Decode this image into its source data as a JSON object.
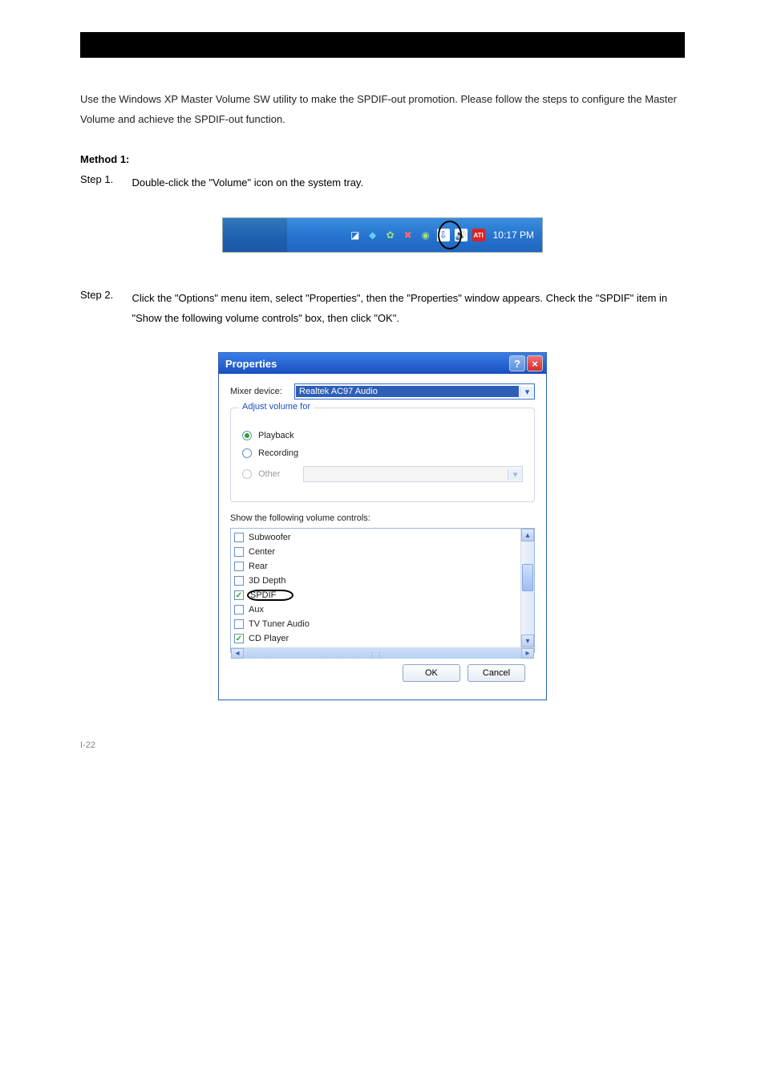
{
  "page_number": "I-22",
  "intro_paragraph": "Use the Windows XP Master Volume SW utility to make the SPDIF-out promotion. Please follow the steps to configure the Master Volume and achieve the SPDIF-out function.",
  "method_title": "Method 1:",
  "steps": [
    {
      "label": "Step 1.",
      "text": "Double-click the \"Volume\" icon on the system tray."
    },
    {
      "label": "Step 2.",
      "text": "Click the \"Options\" menu item, select \"Properties\", then the \"Properties\" window appears. Check the \"SPDIF\" item in \"Show the following volume controls\" box, then click \"OK\"."
    }
  ],
  "taskbar": {
    "clock": "10:17 PM",
    "circled_icon_name": "volume-icon",
    "icons": [
      "white",
      "teal",
      "leaf",
      "red-x",
      "green",
      "white-arrow",
      "volume",
      "red-ati-logo"
    ]
  },
  "dialog": {
    "title": "Properties",
    "mixer_label": "Mixer device:",
    "mixer_value": "Realtek AC97 Audio",
    "group_title": "Adjust volume for",
    "radios": [
      {
        "label": "Playback",
        "checked": true,
        "disabled": false
      },
      {
        "label": "Recording",
        "checked": false,
        "disabled": false
      },
      {
        "label": "Other",
        "checked": false,
        "disabled": true
      }
    ],
    "list_label": "Show the following volume controls:",
    "items": [
      {
        "label": "Subwoofer",
        "checked": false
      },
      {
        "label": "Center",
        "checked": false
      },
      {
        "label": "Rear",
        "checked": false
      },
      {
        "label": "3D Depth",
        "checked": false
      },
      {
        "label": "SPDIF",
        "checked": true,
        "circled": true
      },
      {
        "label": "Aux",
        "checked": false
      },
      {
        "label": "TV Tuner Audio",
        "checked": false
      },
      {
        "label": "CD Player",
        "checked": true
      }
    ],
    "ok_label": "OK",
    "cancel_label": "Cancel"
  }
}
